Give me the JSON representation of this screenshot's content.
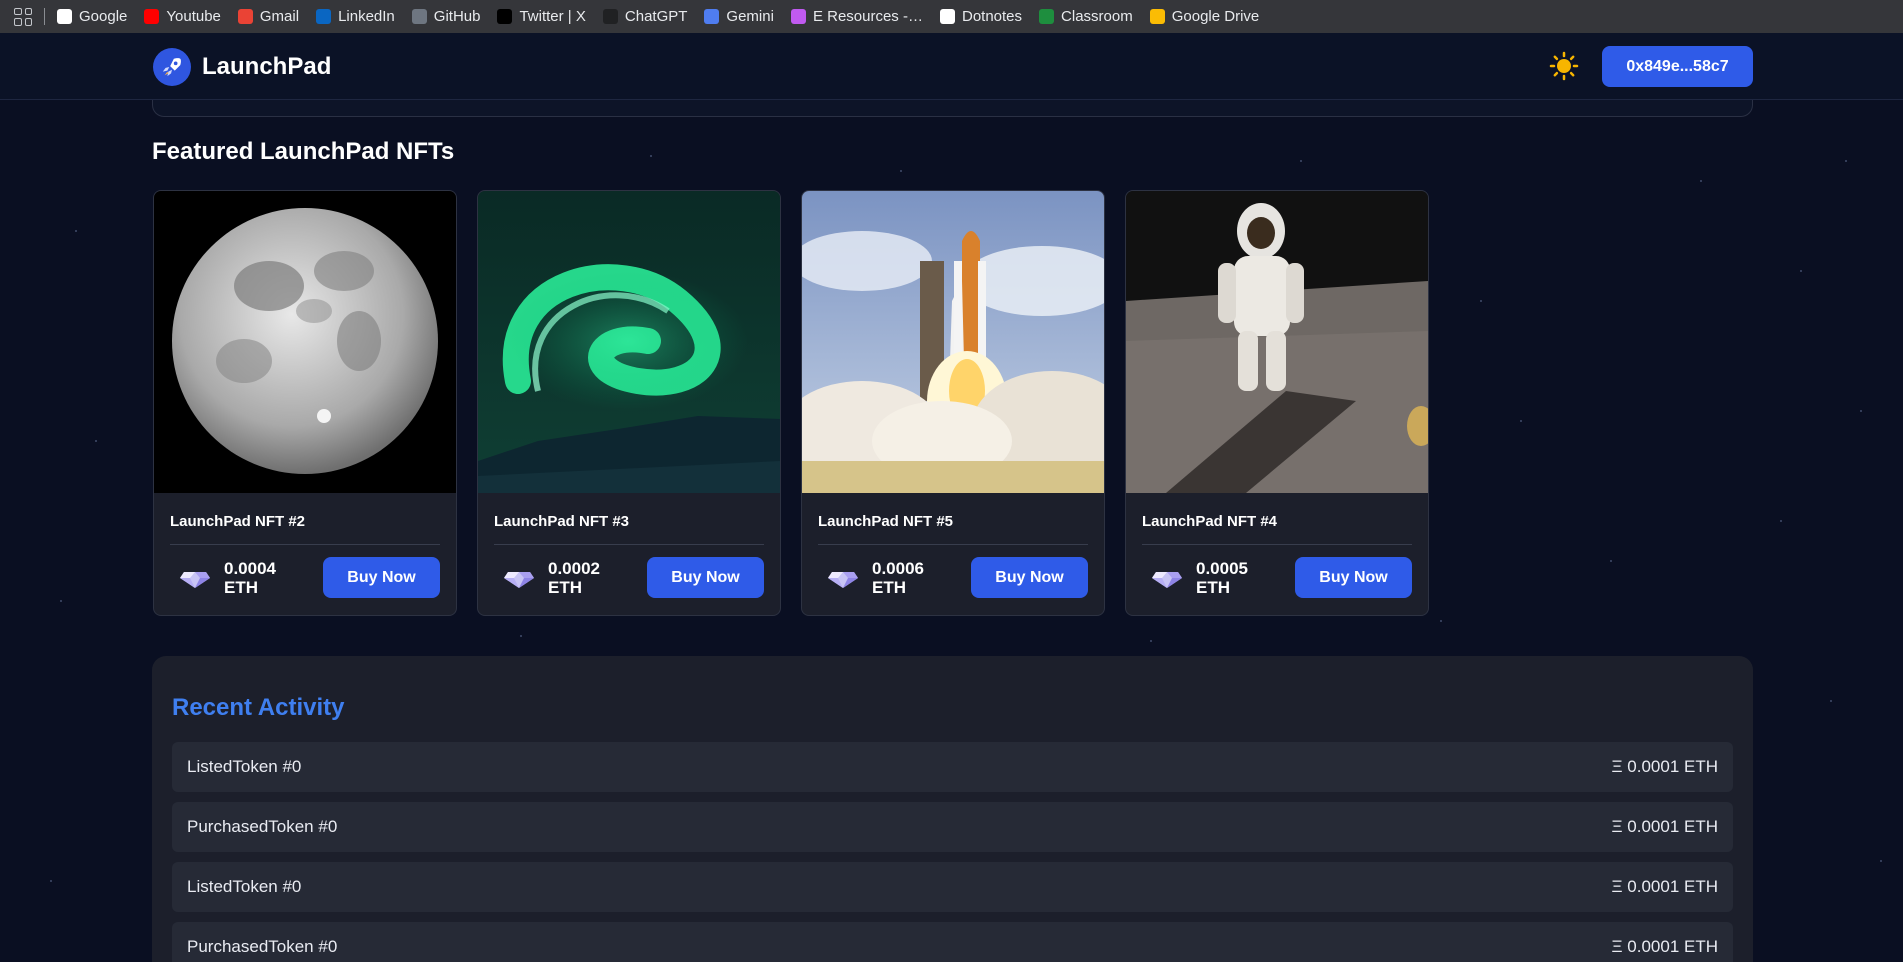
{
  "bookmarks": [
    {
      "label": "Google",
      "icon": "google-icon",
      "color": "#ffffff"
    },
    {
      "label": "Youtube",
      "icon": "youtube-icon",
      "color": "#ff0000"
    },
    {
      "label": "Gmail",
      "icon": "gmail-icon",
      "color": "#ea4335"
    },
    {
      "label": "LinkedIn",
      "icon": "linkedin-icon",
      "color": "#0a66c2"
    },
    {
      "label": "GitHub",
      "icon": "github-icon",
      "color": "#6e7681"
    },
    {
      "label": "Twitter | X",
      "icon": "x-icon",
      "color": "#000000"
    },
    {
      "label": "ChatGPT",
      "icon": "chatgpt-icon",
      "color": "#202123"
    },
    {
      "label": "Gemini",
      "icon": "gemini-icon",
      "color": "#4f7df0"
    },
    {
      "label": "E Resources -…",
      "icon": "eresources-icon",
      "color": "#c05af0"
    },
    {
      "label": "Dotnotes",
      "icon": "dotnotes-icon",
      "color": "#ffffff"
    },
    {
      "label": "Classroom",
      "icon": "classroom-icon",
      "color": "#1e8e3e"
    },
    {
      "label": "Google Drive",
      "icon": "google-drive-icon",
      "color": "#fbbc04"
    }
  ],
  "header": {
    "app_name": "LaunchPad",
    "wallet_address": "0x849e...58c7",
    "theme_icon": "sun-icon"
  },
  "featured": {
    "title": "Featured LaunchPad NFTs",
    "items": [
      {
        "name": "LaunchPad NFT #2",
        "price": "0.0004",
        "unit": "ETH",
        "buy_label": "Buy Now",
        "image": "moon"
      },
      {
        "name": "LaunchPad NFT #3",
        "price": "0.0002",
        "unit": "ETH",
        "buy_label": "Buy Now",
        "image": "aurora"
      },
      {
        "name": "LaunchPad NFT #5",
        "price": "0.0006",
        "unit": "ETH",
        "buy_label": "Buy Now",
        "image": "shuttle-launch"
      },
      {
        "name": "LaunchPad NFT #4",
        "price": "0.0005",
        "unit": "ETH",
        "buy_label": "Buy Now",
        "image": "astronaut"
      }
    ]
  },
  "activity": {
    "title": "Recent Activity",
    "rows": [
      {
        "event": "ListedToken #0",
        "amount": "Ξ 0.0001 ETH"
      },
      {
        "event": "PurchasedToken #0",
        "amount": "Ξ 0.0001 ETH"
      },
      {
        "event": "ListedToken #0",
        "amount": "Ξ 0.0001 ETH"
      },
      {
        "event": "PurchasedToken #0",
        "amount": "Ξ 0.0001 ETH"
      }
    ]
  },
  "colors": {
    "accent": "#2f5be8",
    "activity_title": "#3f7ff0",
    "background": "#0a0f22",
    "card": "#1c1f2b"
  }
}
